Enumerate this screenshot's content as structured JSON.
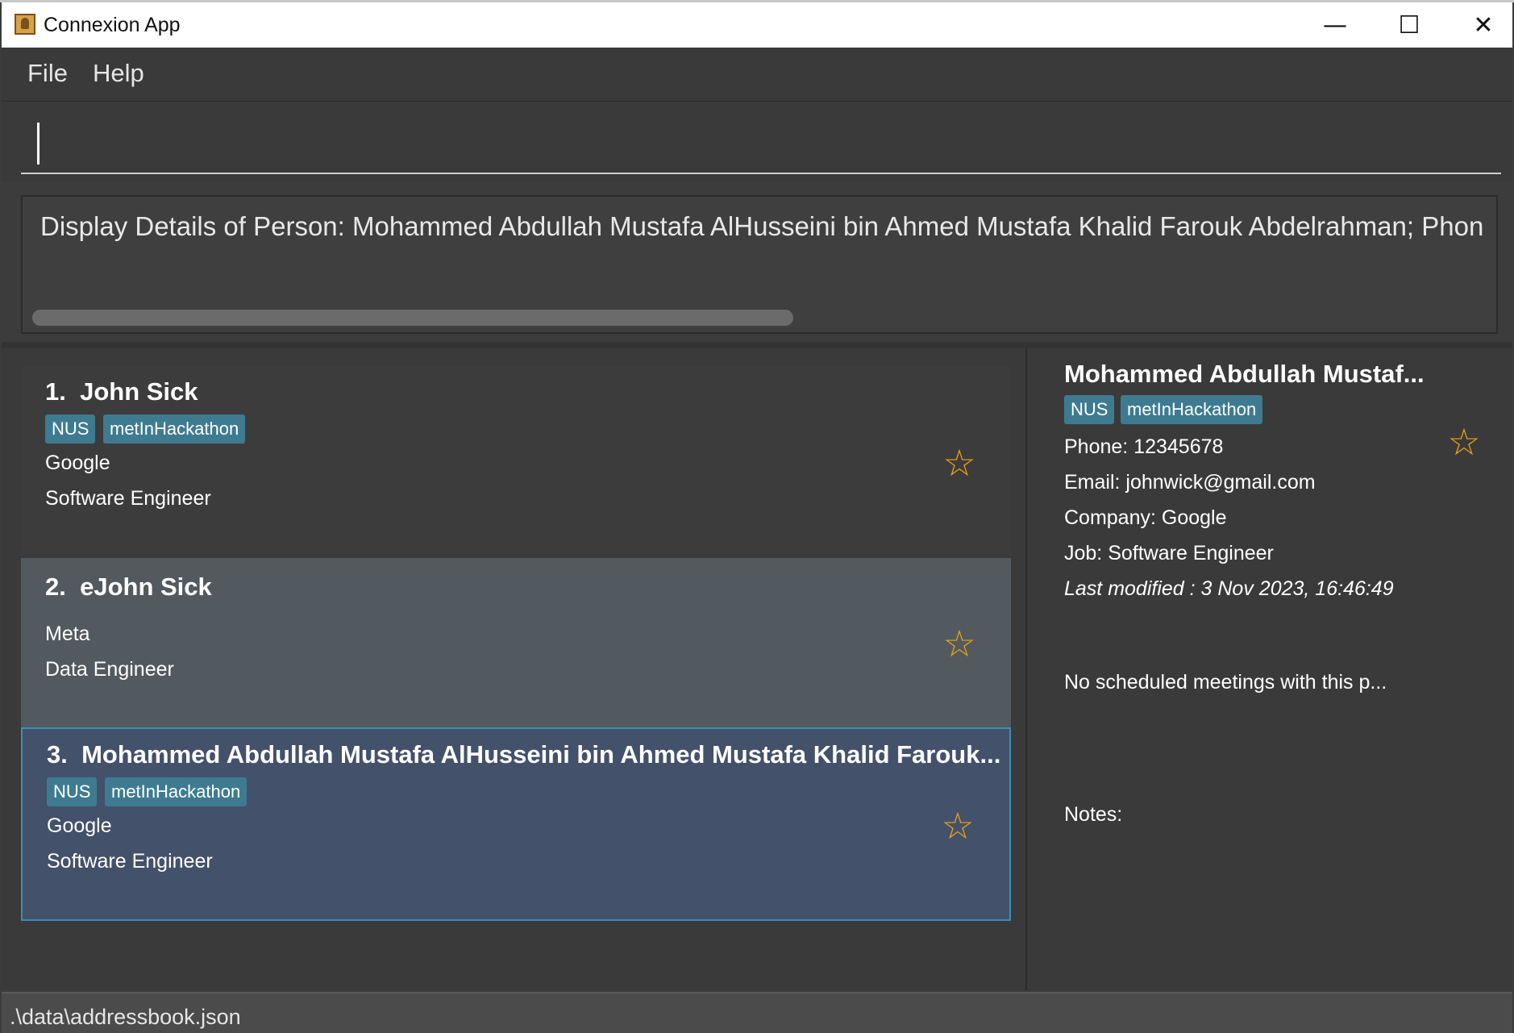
{
  "window": {
    "title": "Connexion App",
    "minimize_glyph": "—",
    "maximize_glyph": "☐",
    "close_glyph": "✕"
  },
  "menu": {
    "file": "File",
    "help": "Help"
  },
  "command": {
    "value": "",
    "placeholder": ""
  },
  "result": {
    "text": "Display Details of Person: Mohammed Abdullah Mustafa AlHusseini bin Ahmed Mustafa Khalid Farouk Abdelrahman; Phone:"
  },
  "persons": [
    {
      "index": "1.",
      "name": "John Sick",
      "tags": [
        "NUS",
        "metInHackathon"
      ],
      "company": "Google",
      "job": "Software Engineer",
      "star": "☆"
    },
    {
      "index": "2.",
      "name": "eJohn Sick",
      "tags": [],
      "company": "Meta",
      "job": "Data Engineer",
      "star": "☆"
    },
    {
      "index": "3.",
      "name": "Mohammed Abdullah Mustafa AlHusseini bin Ahmed Mustafa Khalid Farouk...",
      "tags": [
        "NUS",
        "metInHackathon"
      ],
      "company": "Google",
      "job": "Software Engineer",
      "star": "☆"
    }
  ],
  "detail": {
    "name": "Mohammed Abdullah Mustaf...",
    "tags": [
      "NUS",
      "metInHackathon"
    ],
    "phone": "Phone: 12345678",
    "email": "Email: johnwick@gmail.com",
    "company": "Company: Google",
    "job": "Job: Software Engineer",
    "last_modified": "Last modified : 3 Nov 2023, 16:46:49",
    "meetings": "No scheduled meetings with this p...",
    "notes_label": "Notes:",
    "star": "☆"
  },
  "status": {
    "path": ".\\data\\addressbook.json"
  },
  "colors": {
    "tag": "#3e7b91",
    "star": "#e8a317",
    "selected_card": "#44516a",
    "selected_border": "#3a8fb7",
    "alt_card": "#535a5f"
  }
}
